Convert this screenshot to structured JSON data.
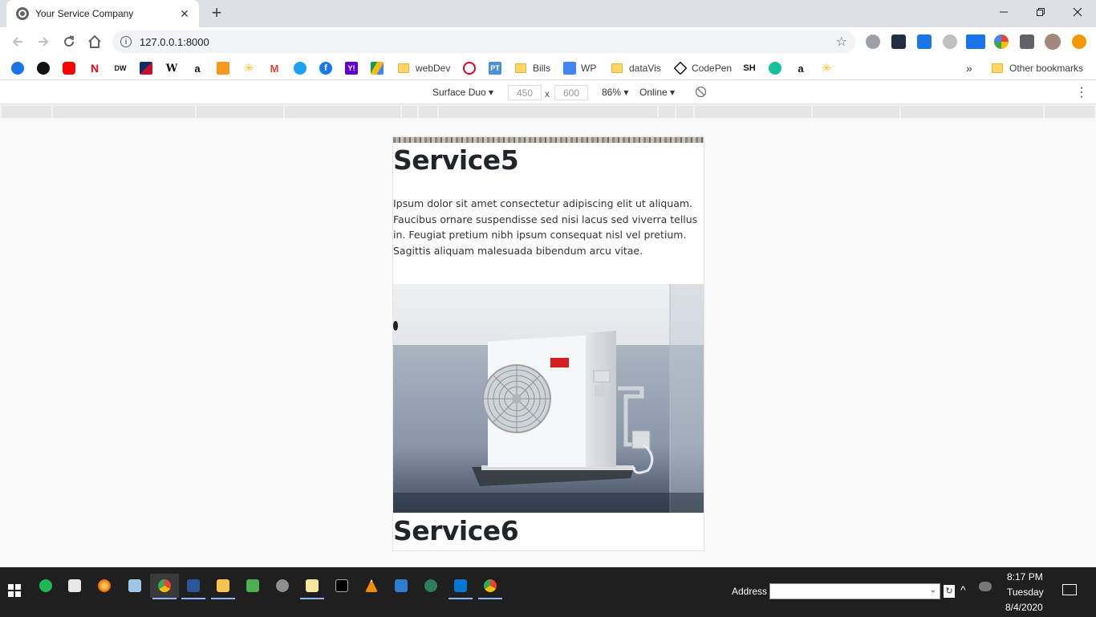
{
  "browser": {
    "tab_title": "Your Service Company",
    "url": "127.0.0.1:8000",
    "new_tab_glyph": "+",
    "close_glyph": "✕"
  },
  "bookmarks": {
    "items": [
      "webDev",
      "Bills",
      "WP",
      "dataVis",
      "CodePen"
    ],
    "icon_labels": {
      "dw": "DW",
      "wiki": "W",
      "amazon": "a",
      "pt": "PT",
      "sh": "SH"
    },
    "overflow": "»",
    "other": "Other bookmarks"
  },
  "device_toolbar": {
    "device": "Surface Duo",
    "width": "450",
    "height": "600",
    "times": "x",
    "zoom": "86%",
    "network": "Online"
  },
  "page": {
    "service5_title": "Service5",
    "service5_text": "Ipsum dolor sit amet consectetur adipiscing elit ut aliquam. Faucibus ornare suspendisse sed nisi lacus sed viverra tellus in. Feugiat pretium nibh ipsum consequat nisl vel pretium. Sagittis aliquam malesuada bibendum arcu vitae.",
    "service6_title": "Service6"
  },
  "taskbar": {
    "address_label": "Address",
    "time": "8:17 PM",
    "day": "Tuesday",
    "date": "8/4/2020"
  },
  "colors": {
    "accent": "#1a73e8",
    "tab_strip": "#dee1e6",
    "taskbar": "#1f1f1f"
  }
}
